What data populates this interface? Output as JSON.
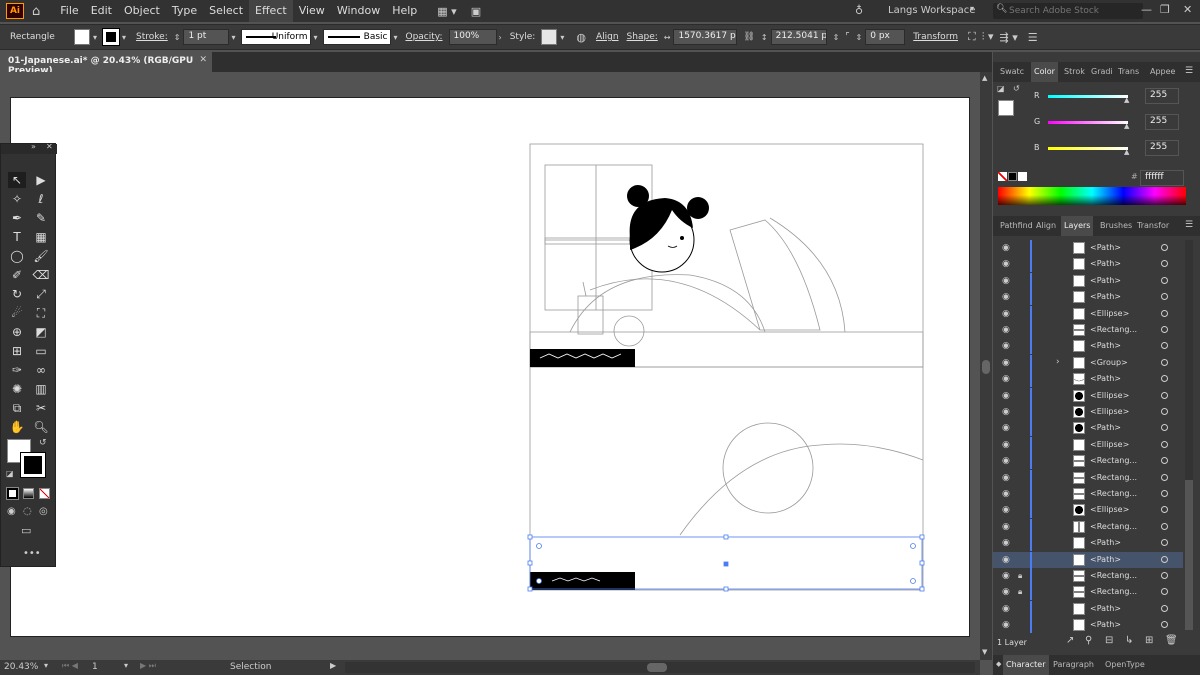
{
  "menu": {
    "logo": "Ai",
    "items": [
      "File",
      "Edit",
      "Object",
      "Type",
      "Select",
      "Effect",
      "View",
      "Window",
      "Help"
    ],
    "workspace": "Langs Workspace",
    "search_placeholder": "Search Adobe Stock"
  },
  "control": {
    "object_type": "Rectangle",
    "stroke_label": "Stroke:",
    "stroke_value": "1 pt",
    "profile": "Uniform",
    "brush": "Basic",
    "opacity_label": "Opacity:",
    "opacity_value": "100%",
    "style_label": "Style:",
    "align_label": "Align",
    "shape_label": "Shape:",
    "width": "1570.3617 p",
    "height": "212.5041 px",
    "radius": "0 px",
    "transform_label": "Transform"
  },
  "document": {
    "tab": "01-Japanese.ai* @ 20.43% (RGB/GPU Preview)"
  },
  "status": {
    "zoom": "20.43%",
    "page": "1",
    "tool": "Selection"
  },
  "color_panel": {
    "tabs": [
      "Swatc",
      "Color",
      "Strok",
      "Gradi",
      "Trans",
      "Appee"
    ],
    "r_label": "R",
    "g_label": "G",
    "b_label": "B",
    "r": "255",
    "g": "255",
    "b": "255",
    "hex": "ffffff"
  },
  "layers_panel": {
    "tabs": [
      "Pathfind",
      "Align",
      "Layers",
      "Brushes",
      "Transfor"
    ],
    "footer": "1 Layer",
    "rows": [
      {
        "name": "<Path>",
        "lock": false,
        "thumb": "white"
      },
      {
        "name": "<Path>",
        "lock": false,
        "thumb": "white"
      },
      {
        "name": "<Path>",
        "lock": false,
        "thumb": "white"
      },
      {
        "name": "<Path>",
        "lock": false,
        "thumb": "white"
      },
      {
        "name": "<Ellipse>",
        "lock": false,
        "thumb": "white"
      },
      {
        "name": "<Rectang...",
        "lock": false,
        "thumb": "line"
      },
      {
        "name": "<Path>",
        "lock": false,
        "thumb": "white"
      },
      {
        "name": "<Group>",
        "lock": false,
        "thumb": "white",
        "expand": true
      },
      {
        "name": "<Path>",
        "lock": false,
        "thumb": "curve"
      },
      {
        "name": "<Ellipse>",
        "lock": false,
        "thumb": "black"
      },
      {
        "name": "<Ellipse>",
        "lock": false,
        "thumb": "black"
      },
      {
        "name": "<Path>",
        "lock": false,
        "thumb": "half"
      },
      {
        "name": "<Ellipse>",
        "lock": false,
        "thumb": "white"
      },
      {
        "name": "<Rectang...",
        "lock": false,
        "thumb": "line"
      },
      {
        "name": "<Rectang...",
        "lock": false,
        "thumb": "line"
      },
      {
        "name": "<Rectang...",
        "lock": false,
        "thumb": "line"
      },
      {
        "name": "<Ellipse>",
        "lock": false,
        "thumb": "black"
      },
      {
        "name": "<Rectang...",
        "lock": false,
        "thumb": "vline"
      },
      {
        "name": "<Path>",
        "lock": false,
        "thumb": "white"
      },
      {
        "name": "<Path>",
        "lock": false,
        "thumb": "white",
        "selected": true
      },
      {
        "name": "<Rectang...",
        "lock": true,
        "thumb": "line"
      },
      {
        "name": "<Rectang...",
        "lock": true,
        "thumb": "line"
      },
      {
        "name": "<Path>",
        "lock": false,
        "thumb": "white"
      },
      {
        "name": "<Path>",
        "lock": false,
        "thumb": "white"
      }
    ]
  },
  "bottom_tabs": [
    "Character",
    "Paragraph",
    "OpenType"
  ]
}
